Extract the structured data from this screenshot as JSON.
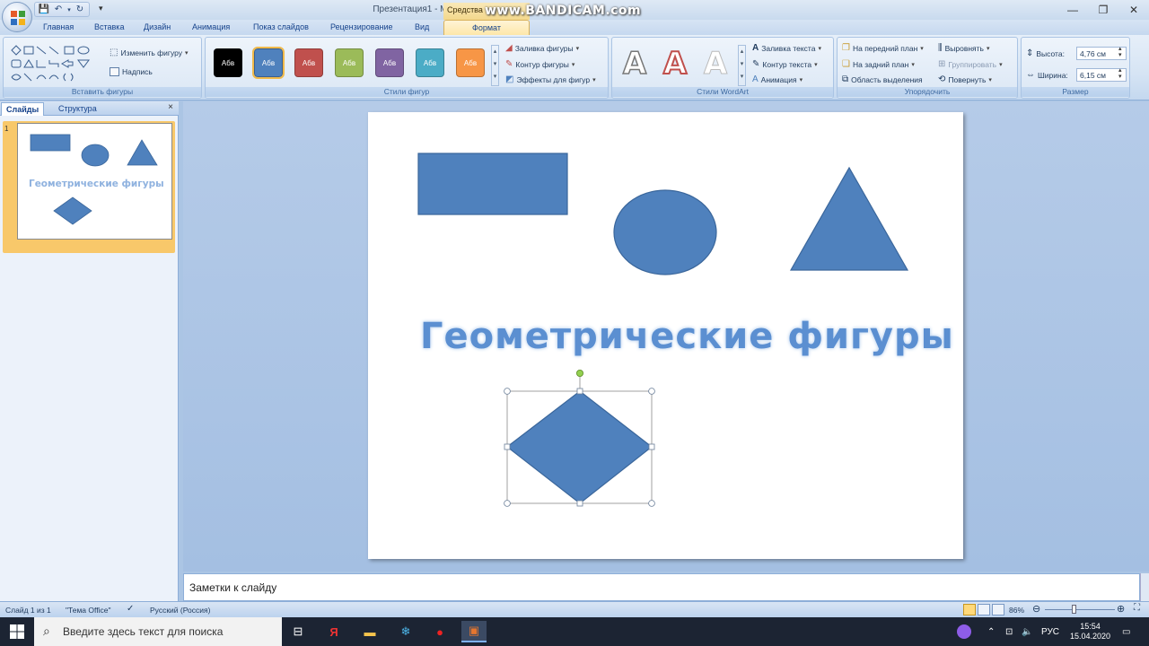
{
  "window": {
    "title": "Презентация1 - Microsoft PowerPoint",
    "context_tab_group": "Средства",
    "watermark": "www.BANDICAM.com"
  },
  "tabs": [
    {
      "label": "Главная"
    },
    {
      "label": "Вставка"
    },
    {
      "label": "Дизайн"
    },
    {
      "label": "Анимация"
    },
    {
      "label": "Показ слайдов"
    },
    {
      "label": "Рецензирование"
    },
    {
      "label": "Вид"
    },
    {
      "label": "Формат",
      "active": true
    }
  ],
  "ribbon": {
    "insert_shapes": {
      "label": "Вставить фигуры",
      "change_shape": "Изменить фигуру",
      "text_box": "Надпись"
    },
    "shape_styles": {
      "label": "Стили фигур",
      "swatches": [
        {
          "text": "Абв",
          "color": "#000000"
        },
        {
          "text": "Абв",
          "color": "#4f81bd"
        },
        {
          "text": "Абв",
          "color": "#c0504d"
        },
        {
          "text": "Абв",
          "color": "#9bbb59"
        },
        {
          "text": "Абв",
          "color": "#8064a2"
        },
        {
          "text": "Абв",
          "color": "#4bacc6"
        },
        {
          "text": "Абв",
          "color": "#f79646"
        }
      ],
      "fill": "Заливка фигуры",
      "outline": "Контур фигуры",
      "effects": "Эффекты для фигур"
    },
    "wordart": {
      "label": "Стили WordArt",
      "sample": "A",
      "text_fill": "Заливка текста",
      "text_outline": "Контур текста",
      "animation": "Анимация"
    },
    "arrange": {
      "label": "Упорядочить",
      "bring_front": "На передний план",
      "send_back": "На задний план",
      "selection_pane": "Область выделения",
      "align": "Выровнять",
      "group": "Группировать",
      "rotate": "Повернуть"
    },
    "size": {
      "label": "Размер",
      "height_label": "Высота:",
      "height_value": "4,76 см",
      "width_label": "Ширина:",
      "width_value": "6,15 см"
    }
  },
  "left_panel": {
    "tab_slides": "Слайды",
    "tab_outline": "Структура",
    "close": "×",
    "slide_number": "1",
    "thumb_title": "Геометрические фигуры"
  },
  "slide": {
    "title": "Геометрические фигуры",
    "shape_color": "#4f81bd",
    "shape_stroke": "#3a669b"
  },
  "notes": {
    "placeholder": "Заметки к слайду"
  },
  "statusbar": {
    "slide_info": "Слайд 1 из 1",
    "theme": "\"Тема Office\"",
    "language": "Русский (Россия)",
    "zoom": "86%"
  },
  "taskbar": {
    "search_placeholder": "Введите здесь текст для поиска",
    "lang": "РУС",
    "time": "15:54",
    "date": "15.04.2020"
  }
}
